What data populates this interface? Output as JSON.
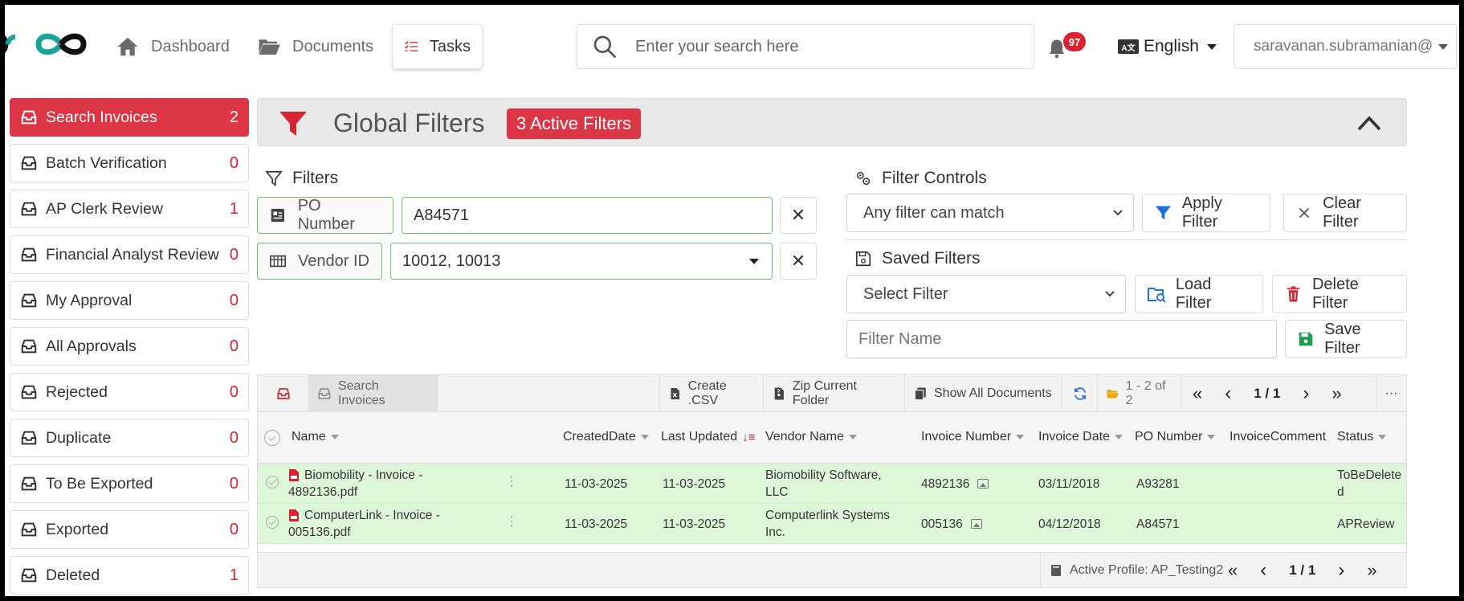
{
  "topbar": {
    "nav": [
      {
        "label": "Dashboard",
        "icon": "home-icon"
      },
      {
        "label": "Documents",
        "icon": "folder-icon"
      },
      {
        "label": "Tasks",
        "icon": "tasks-icon",
        "active": true
      }
    ],
    "search_placeholder": "Enter your search here",
    "notifications_count": "97",
    "language": "English",
    "user": "saravanan.subramanian@"
  },
  "sidebar": {
    "items": [
      {
        "label": "Search Invoices",
        "count": "2",
        "active": true
      },
      {
        "label": "Batch Verification",
        "count": "0"
      },
      {
        "label": "AP Clerk Review",
        "count": "1"
      },
      {
        "label": "Financial Analyst Review",
        "count": "0"
      },
      {
        "label": "My Approval",
        "count": "0"
      },
      {
        "label": "All Approvals",
        "count": "0"
      },
      {
        "label": "Rejected",
        "count": "0"
      },
      {
        "label": "Duplicate",
        "count": "0"
      },
      {
        "label": "To Be Exported",
        "count": "0"
      },
      {
        "label": "Exported",
        "count": "0"
      },
      {
        "label": "Deleted",
        "count": "1"
      }
    ]
  },
  "global_filters": {
    "title": "Global Filters",
    "active_badge": "3 Active Filters"
  },
  "filters": {
    "title": "Filters",
    "po_label": "PO Number",
    "po_value": "A84571",
    "vendor_label": "Vendor ID",
    "vendor_value": "10012, 10013",
    "clear_symbol": "✕"
  },
  "filter_controls": {
    "title": "Filter Controls",
    "match_mode": "Any filter can match",
    "apply": "Apply Filter",
    "clear": "Clear Filter",
    "saved_title": "Saved Filters",
    "select_placeholder": "Select Filter",
    "load": "Load Filter",
    "delete": "Delete Filter",
    "name_placeholder": "Filter Name",
    "save": "Save Filter"
  },
  "grid": {
    "toolbar": {
      "tab_label": "Search Invoices",
      "create_csv": "Create .CSV",
      "zip_folder": "Zip Current Folder",
      "show_all": "Show All Documents",
      "range": "1 - 2 of 2",
      "first": "«",
      "prev": "‹",
      "page": "1 / 1",
      "next": "›",
      "last": "»",
      "more": "···"
    },
    "columns": [
      "Name",
      "CreatedDate",
      "Last Updated",
      "Vendor Name",
      "Invoice Number",
      "Invoice Date",
      "PO Number",
      "InvoiceComment",
      "Status"
    ],
    "rows": [
      {
        "name_line1": "Biomobility - Invoice -",
        "name_line2": "4892136.pdf",
        "created": "11-03-2025",
        "updated": "11-03-2025",
        "vendor_line1": "Biomobility Software,",
        "vendor_line2": "LLC",
        "invoice_number": "4892136",
        "invoice_date": "03/11/2018",
        "po_number": "A93281",
        "comment": "",
        "status_line1": "ToBeDelete",
        "status_line2": "d"
      },
      {
        "name_line1": "ComputerLink - Invoice -",
        "name_line2": "005136.pdf",
        "created": "11-03-2025",
        "updated": "11-03-2025",
        "vendor_line1": "Computerlink Systems",
        "vendor_line2": "Inc.",
        "invoice_number": "005136",
        "invoice_date": "04/12/2018",
        "po_number": "A84571",
        "comment": "",
        "status_line1": "APReview",
        "status_line2": ""
      }
    ],
    "footer": {
      "profile": "Active Profile: AP_Testing2",
      "first": "«",
      "prev": "‹",
      "page": "1 / 1",
      "next": "›",
      "last": "»"
    }
  },
  "colors": {
    "accent_red": "#dc3545",
    "filter_green": "#6fbf73",
    "row_green": "#dff7d9",
    "logo_teal": "#1aa39a",
    "apply_blue": "#1e6fd9"
  }
}
